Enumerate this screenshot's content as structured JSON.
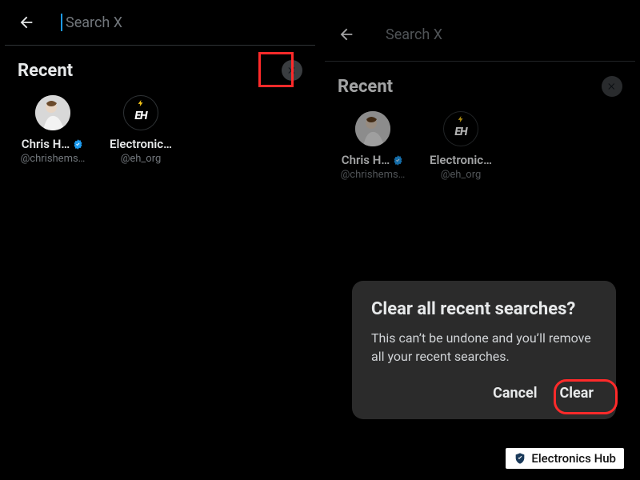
{
  "search": {
    "placeholder": "Search X"
  },
  "recent_label": "Recent",
  "recents": [
    {
      "name": "Chris H…",
      "handle": "@chrishems…",
      "verified": true,
      "avatar": "chris"
    },
    {
      "name": "Electronic…",
      "handle": "@eh_org",
      "verified": false,
      "avatar": "eh"
    }
  ],
  "dialog": {
    "title": "Clear all recent searches?",
    "body": "This can’t be undone and you’ll remove all your recent searches.",
    "cancel": "Cancel",
    "confirm": "Clear"
  },
  "watermark": "Electronics Hub"
}
